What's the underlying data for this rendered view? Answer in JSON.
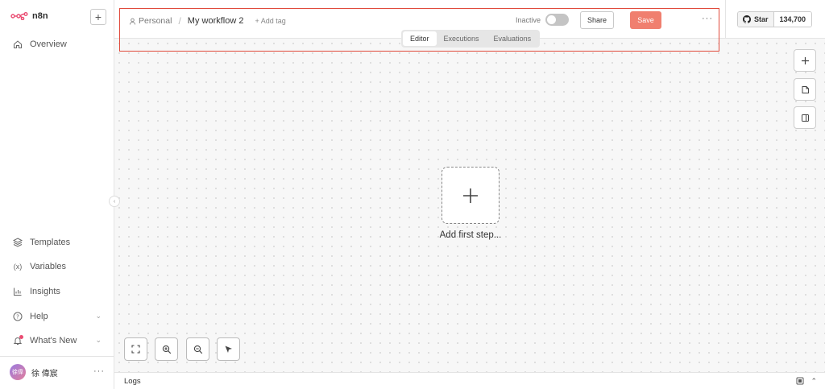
{
  "app": {
    "name": "n8n",
    "accent": "#ea4b71"
  },
  "sidebar": {
    "add_label": "+",
    "collapse_icon": "‹",
    "top_items": [
      {
        "label": "Overview",
        "icon": "home-icon"
      }
    ],
    "bottom_items": [
      {
        "label": "Templates",
        "icon": "box-icon"
      },
      {
        "label": "Variables",
        "icon": "variables-icon"
      },
      {
        "label": "Insights",
        "icon": "chart-icon"
      },
      {
        "label": "Help",
        "icon": "help-icon",
        "has_chevron": true
      },
      {
        "label": "What's New",
        "icon": "bell-icon",
        "has_chevron": true,
        "has_dot": true
      }
    ],
    "user": {
      "name": "徐 偉宸",
      "avatar_text": "徐偉",
      "more": "···"
    }
  },
  "header": {
    "project": "Personal",
    "separator": "/",
    "workflow_name": "My workflow 2",
    "add_tag": "+ Add tag",
    "status_label": "Inactive",
    "share_label": "Share",
    "save_label": "Save",
    "save_color": "#f07f6f",
    "more": "···",
    "tabs": [
      {
        "label": "Editor",
        "active": true
      },
      {
        "label": "Executions",
        "active": false
      },
      {
        "label": "Evaluations",
        "active": false
      }
    ]
  },
  "github": {
    "star_label": "Star",
    "count": "134,700"
  },
  "canvas": {
    "add_first_step": "Add first step..."
  },
  "logs": {
    "label": "Logs"
  }
}
